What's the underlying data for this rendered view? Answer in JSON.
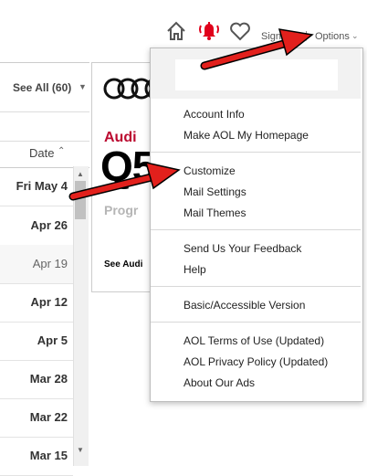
{
  "header": {
    "signout_label": "Sign Out",
    "separator": "|",
    "options_label": "Options",
    "icons": [
      "home-icon",
      "bell-icon",
      "heart-icon"
    ],
    "bell_color": "#e0001b"
  },
  "mail_list": {
    "see_all_label": "See All (60)",
    "sort_label": "Date",
    "dates": [
      "Fri May 4",
      "Apr 26",
      "Apr 19",
      "Apr 12",
      "Apr 5",
      "Mar 28",
      "Mar 22",
      "Mar 15"
    ]
  },
  "ad": {
    "brand": "Audi",
    "model": "Q5",
    "tagline_fragment": "Progr",
    "link_fragment": "See Audi"
  },
  "options_menu": {
    "groups": [
      [
        "Account Info",
        "Make AOL My Homepage"
      ],
      [
        "Customize",
        "Mail Settings",
        "Mail Themes"
      ],
      [
        "Send Us Your Feedback",
        "Help"
      ],
      [
        "Basic/Accessible Version"
      ],
      [
        "AOL Terms of Use (Updated)",
        "AOL Privacy Policy (Updated)",
        "About Our Ads"
      ]
    ]
  },
  "annotation_color": "#e2201c"
}
